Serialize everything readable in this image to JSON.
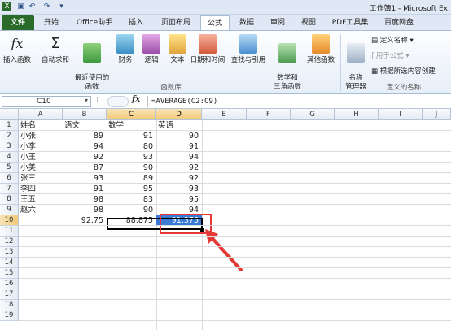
{
  "window": {
    "title": "工作簿1 - Microsoft Ex"
  },
  "tabs": [
    "文件",
    "开始",
    "Office助手",
    "插入",
    "页面布局",
    "公式",
    "数据",
    "审阅",
    "视图",
    "PDF工具集",
    "百度网盘"
  ],
  "ribbon": {
    "insert_function": "插入函数",
    "autosum": "自动求和",
    "recent": "最近使用的\n函数",
    "financial": "财务",
    "logical": "逻辑",
    "text": "文本",
    "datetime": "日期和时间",
    "lookup": "查找与引用",
    "math": "数学和\n三角函数",
    "more": "其他函数",
    "group_library": "函数库",
    "name_manager": "名称\n管理器",
    "define_name": "定义名称",
    "use_in_formula": "用于公式",
    "create_from_selection": "根据所选内容创建",
    "group_names": "定义的名称"
  },
  "formula_bar": {
    "name_box": "C10",
    "fx": "fx",
    "formula": "=AVERAGE(C2:C9)"
  },
  "columns": [
    "A",
    "B",
    "C",
    "D",
    "E",
    "F",
    "G",
    "H",
    "I",
    "J"
  ],
  "rows": [
    "1",
    "2",
    "3",
    "4",
    "5",
    "6",
    "7",
    "8",
    "9",
    "10",
    "11",
    "12",
    "13",
    "14",
    "15",
    "16",
    "17",
    "18",
    "19"
  ],
  "header_row": [
    "姓名",
    "语文",
    "数学",
    "英语"
  ],
  "data_rows": [
    [
      "小张",
      "89",
      "91",
      "90"
    ],
    [
      "小李",
      "94",
      "80",
      "91"
    ],
    [
      "小王",
      "92",
      "93",
      "94"
    ],
    [
      "小美",
      "87",
      "90",
      "92"
    ],
    [
      "张三",
      "93",
      "89",
      "92"
    ],
    [
      "李四",
      "91",
      "95",
      "93"
    ],
    [
      "王五",
      "98",
      "83",
      "95"
    ],
    [
      "赵六",
      "98",
      "90",
      "94"
    ]
  ],
  "summary_row": [
    "",
    "92.75",
    "88.875",
    "91.375"
  ],
  "colors": {
    "accent_green": "#2a6a2a",
    "annotation_red": "#e53935",
    "selection_blue": "#3a7bd5"
  }
}
